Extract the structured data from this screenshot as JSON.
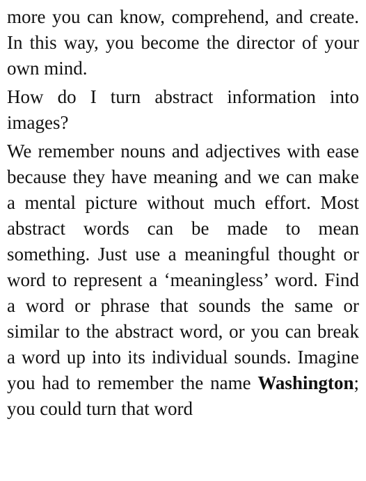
{
  "document": {
    "paragraph_1": "more you can know, comprehend, and create. In this way, you become the director of your own mind.",
    "paragraph_2": "How do I turn abstract information into images?",
    "paragraph_3": {
      "text_before": "We remember nouns and adjectives with ease because they have meaning and we can make a mental picture without much effort. Most abstract words can be made to mean something. Just use a meaningful thought or word to represent a ‘meaningless’ word. Find a word or phrase that sounds the same or similar to the abstract word, or you can break a word up into its individual sounds. Imagine you had to remember the name ",
      "bold_term": "Washington",
      "text_after": "; you could turn that word"
    }
  }
}
